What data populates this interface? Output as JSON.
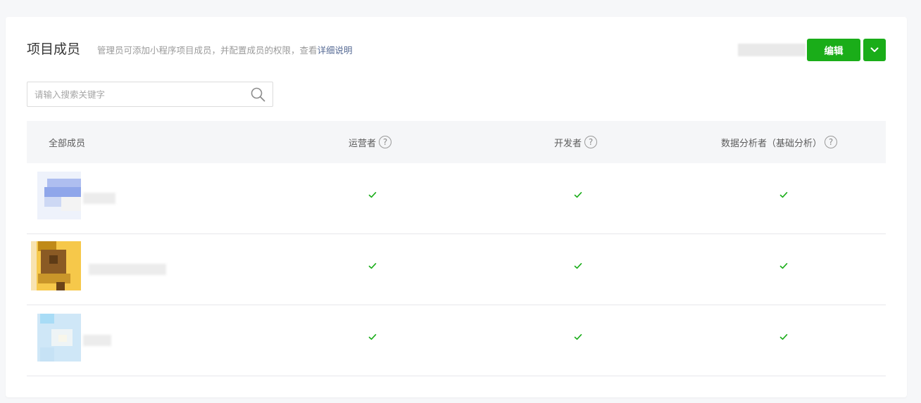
{
  "header": {
    "title": "项目成员",
    "description": "管理员可添加小程序项目成员，并配置成员的权限，查看",
    "description_link": "详细说明",
    "edit_label": "编辑"
  },
  "search": {
    "placeholder": "请输入搜索关键字",
    "value": ""
  },
  "table": {
    "columns": [
      "全部成员",
      "运营者",
      "开发者",
      "数据分析者（基础分析）"
    ],
    "help_mark": "?",
    "rows": [
      {
        "operator": true,
        "developer": true,
        "analyst": true
      },
      {
        "operator": true,
        "developer": true,
        "analyst": true
      },
      {
        "operator": true,
        "developer": true,
        "analyst": true
      }
    ]
  },
  "colors": {
    "accent": "#1aad19",
    "link": "#576b95",
    "check": "#1aad19"
  },
  "icons": [
    "search-icon",
    "chevron-down-icon",
    "help-icon",
    "check-icon"
  ]
}
